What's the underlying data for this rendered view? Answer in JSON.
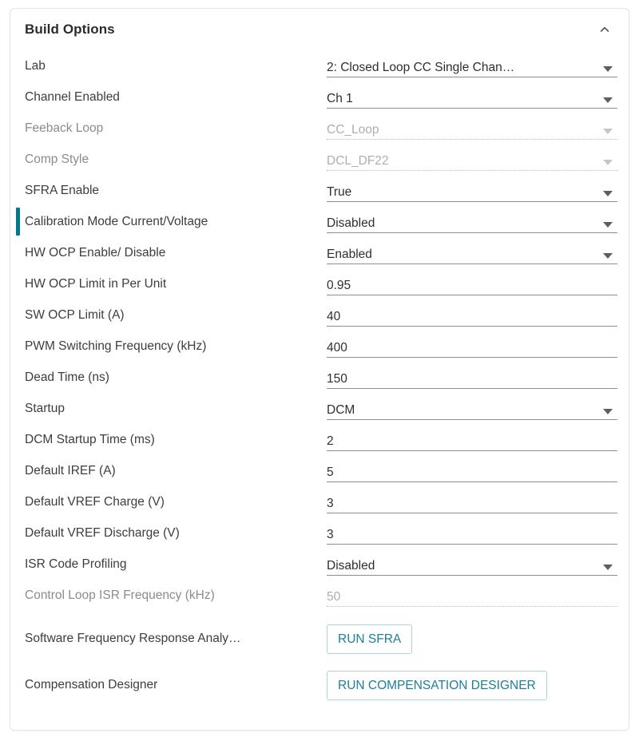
{
  "panel": {
    "title": "Build Options",
    "collapse_icon": "chevron-up-icon",
    "accent_color": "#00778b",
    "button_color": "#1b7f99"
  },
  "rows": [
    {
      "label": "Lab",
      "value": "2: Closed Loop CC Single Chan…",
      "type": "select",
      "disabled": false,
      "selected": false
    },
    {
      "label": "Channel Enabled",
      "value": "Ch 1",
      "type": "select",
      "disabled": false,
      "selected": false
    },
    {
      "label": "Feeback Loop",
      "value": "CC_Loop",
      "type": "select",
      "disabled": true,
      "selected": false
    },
    {
      "label": "Comp Style",
      "value": "DCL_DF22",
      "type": "select",
      "disabled": true,
      "selected": false
    },
    {
      "label": "SFRA Enable",
      "value": "True",
      "type": "select",
      "disabled": false,
      "selected": false
    },
    {
      "label": "Calibration Mode Current/Voltage",
      "value": "Disabled",
      "type": "select",
      "disabled": false,
      "selected": true
    },
    {
      "label": "HW OCP Enable/ Disable",
      "value": "Enabled",
      "type": "select",
      "disabled": false,
      "selected": false
    },
    {
      "label": "HW OCP Limit in Per Unit",
      "value": "0.95",
      "type": "text",
      "disabled": false,
      "selected": false
    },
    {
      "label": "SW OCP Limit (A)",
      "value": "40",
      "type": "text",
      "disabled": false,
      "selected": false
    },
    {
      "label": "PWM Switching Frequency (kHz)",
      "value": "400",
      "type": "text",
      "disabled": false,
      "selected": false
    },
    {
      "label": "Dead Time (ns)",
      "value": "150",
      "type": "text",
      "disabled": false,
      "selected": false
    },
    {
      "label": "Startup",
      "value": "DCM",
      "type": "select",
      "disabled": false,
      "selected": false
    },
    {
      "label": "DCM Startup Time (ms)",
      "value": "2",
      "type": "text",
      "disabled": false,
      "selected": false
    },
    {
      "label": "Default IREF (A)",
      "value": "5",
      "type": "text",
      "disabled": false,
      "selected": false
    },
    {
      "label": "Default VREF Charge (V)",
      "value": "3",
      "type": "text",
      "disabled": false,
      "selected": false
    },
    {
      "label": "Default VREF Discharge (V)",
      "value": "3",
      "type": "text",
      "disabled": false,
      "selected": false
    },
    {
      "label": "ISR Code Profiling",
      "value": "Disabled",
      "type": "select",
      "disabled": false,
      "selected": false
    },
    {
      "label": "Control Loop ISR Frequency (kHz)",
      "value": "50",
      "type": "text",
      "disabled": true,
      "selected": false
    }
  ],
  "actions": [
    {
      "label": "Software Frequency Response Analy…",
      "button": "RUN SFRA"
    },
    {
      "label": "Compensation Designer",
      "button": "RUN COMPENSATION DESIGNER"
    }
  ]
}
